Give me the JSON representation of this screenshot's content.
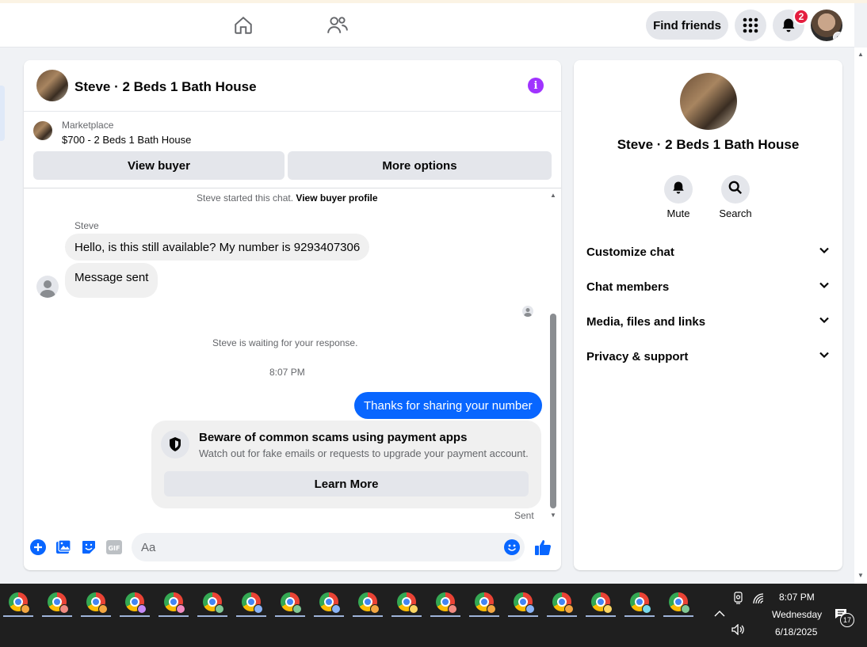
{
  "nav": {
    "find_friends": "Find friends",
    "notification_count": "2",
    "icons": [
      "home-icon",
      "friends-icon",
      "menu-grid-icon",
      "bell-icon"
    ]
  },
  "chat": {
    "title": "Steve · 2 Beds 1 Bath House",
    "marketplace_label": "Marketplace",
    "listing": "$700 - 2 Beds 1 Bath House",
    "view_buyer": "View buyer",
    "more_options": "More options",
    "started_text": "Steve started this chat.",
    "started_link": "View buyer profile",
    "sender_name": "Steve",
    "messages_in": [
      "Hello, is this still available? My number is 9293407306",
      "Message sent"
    ],
    "waiting_text": "Steve is waiting for your response.",
    "timestamp": "8:07 PM",
    "message_out": "Thanks for sharing your number",
    "scam_title": "Beware of common scams using payment apps",
    "scam_subtitle": "Watch out for fake emails or requests to upgrade your payment account.",
    "learn_more": "Learn More",
    "sent_label": "Sent",
    "composer_placeholder": "Aa",
    "composer_icons": [
      "plus-icon",
      "photo-icon",
      "sticker-icon",
      "gif-icon",
      "emoji-icon",
      "thumbs-up-icon"
    ]
  },
  "panel": {
    "title": "Steve · 2 Beds 1 Bath House",
    "mute": "Mute",
    "search": "Search",
    "sections": [
      "Customize chat",
      "Chat members",
      "Media, files and links",
      "Privacy & support"
    ]
  },
  "taskbar": {
    "time": "8:07 PM",
    "day": "Wednesday",
    "date": "6/18/2025",
    "notif_count": "17",
    "profile_colors": [
      "#f4a742",
      "#f28b82",
      "#f4a742",
      "#c58af9",
      "#f28bc1",
      "#81c995",
      "#8ab4f8",
      "#81c995",
      "#8ab4f8",
      "#f4a742",
      "#fdd663",
      "#f28b82",
      "#f4a742",
      "#8ab4f8",
      "#f4a742",
      "#fdd663",
      "#78d9ec",
      "#81c995"
    ],
    "accent": "#0866ff"
  }
}
